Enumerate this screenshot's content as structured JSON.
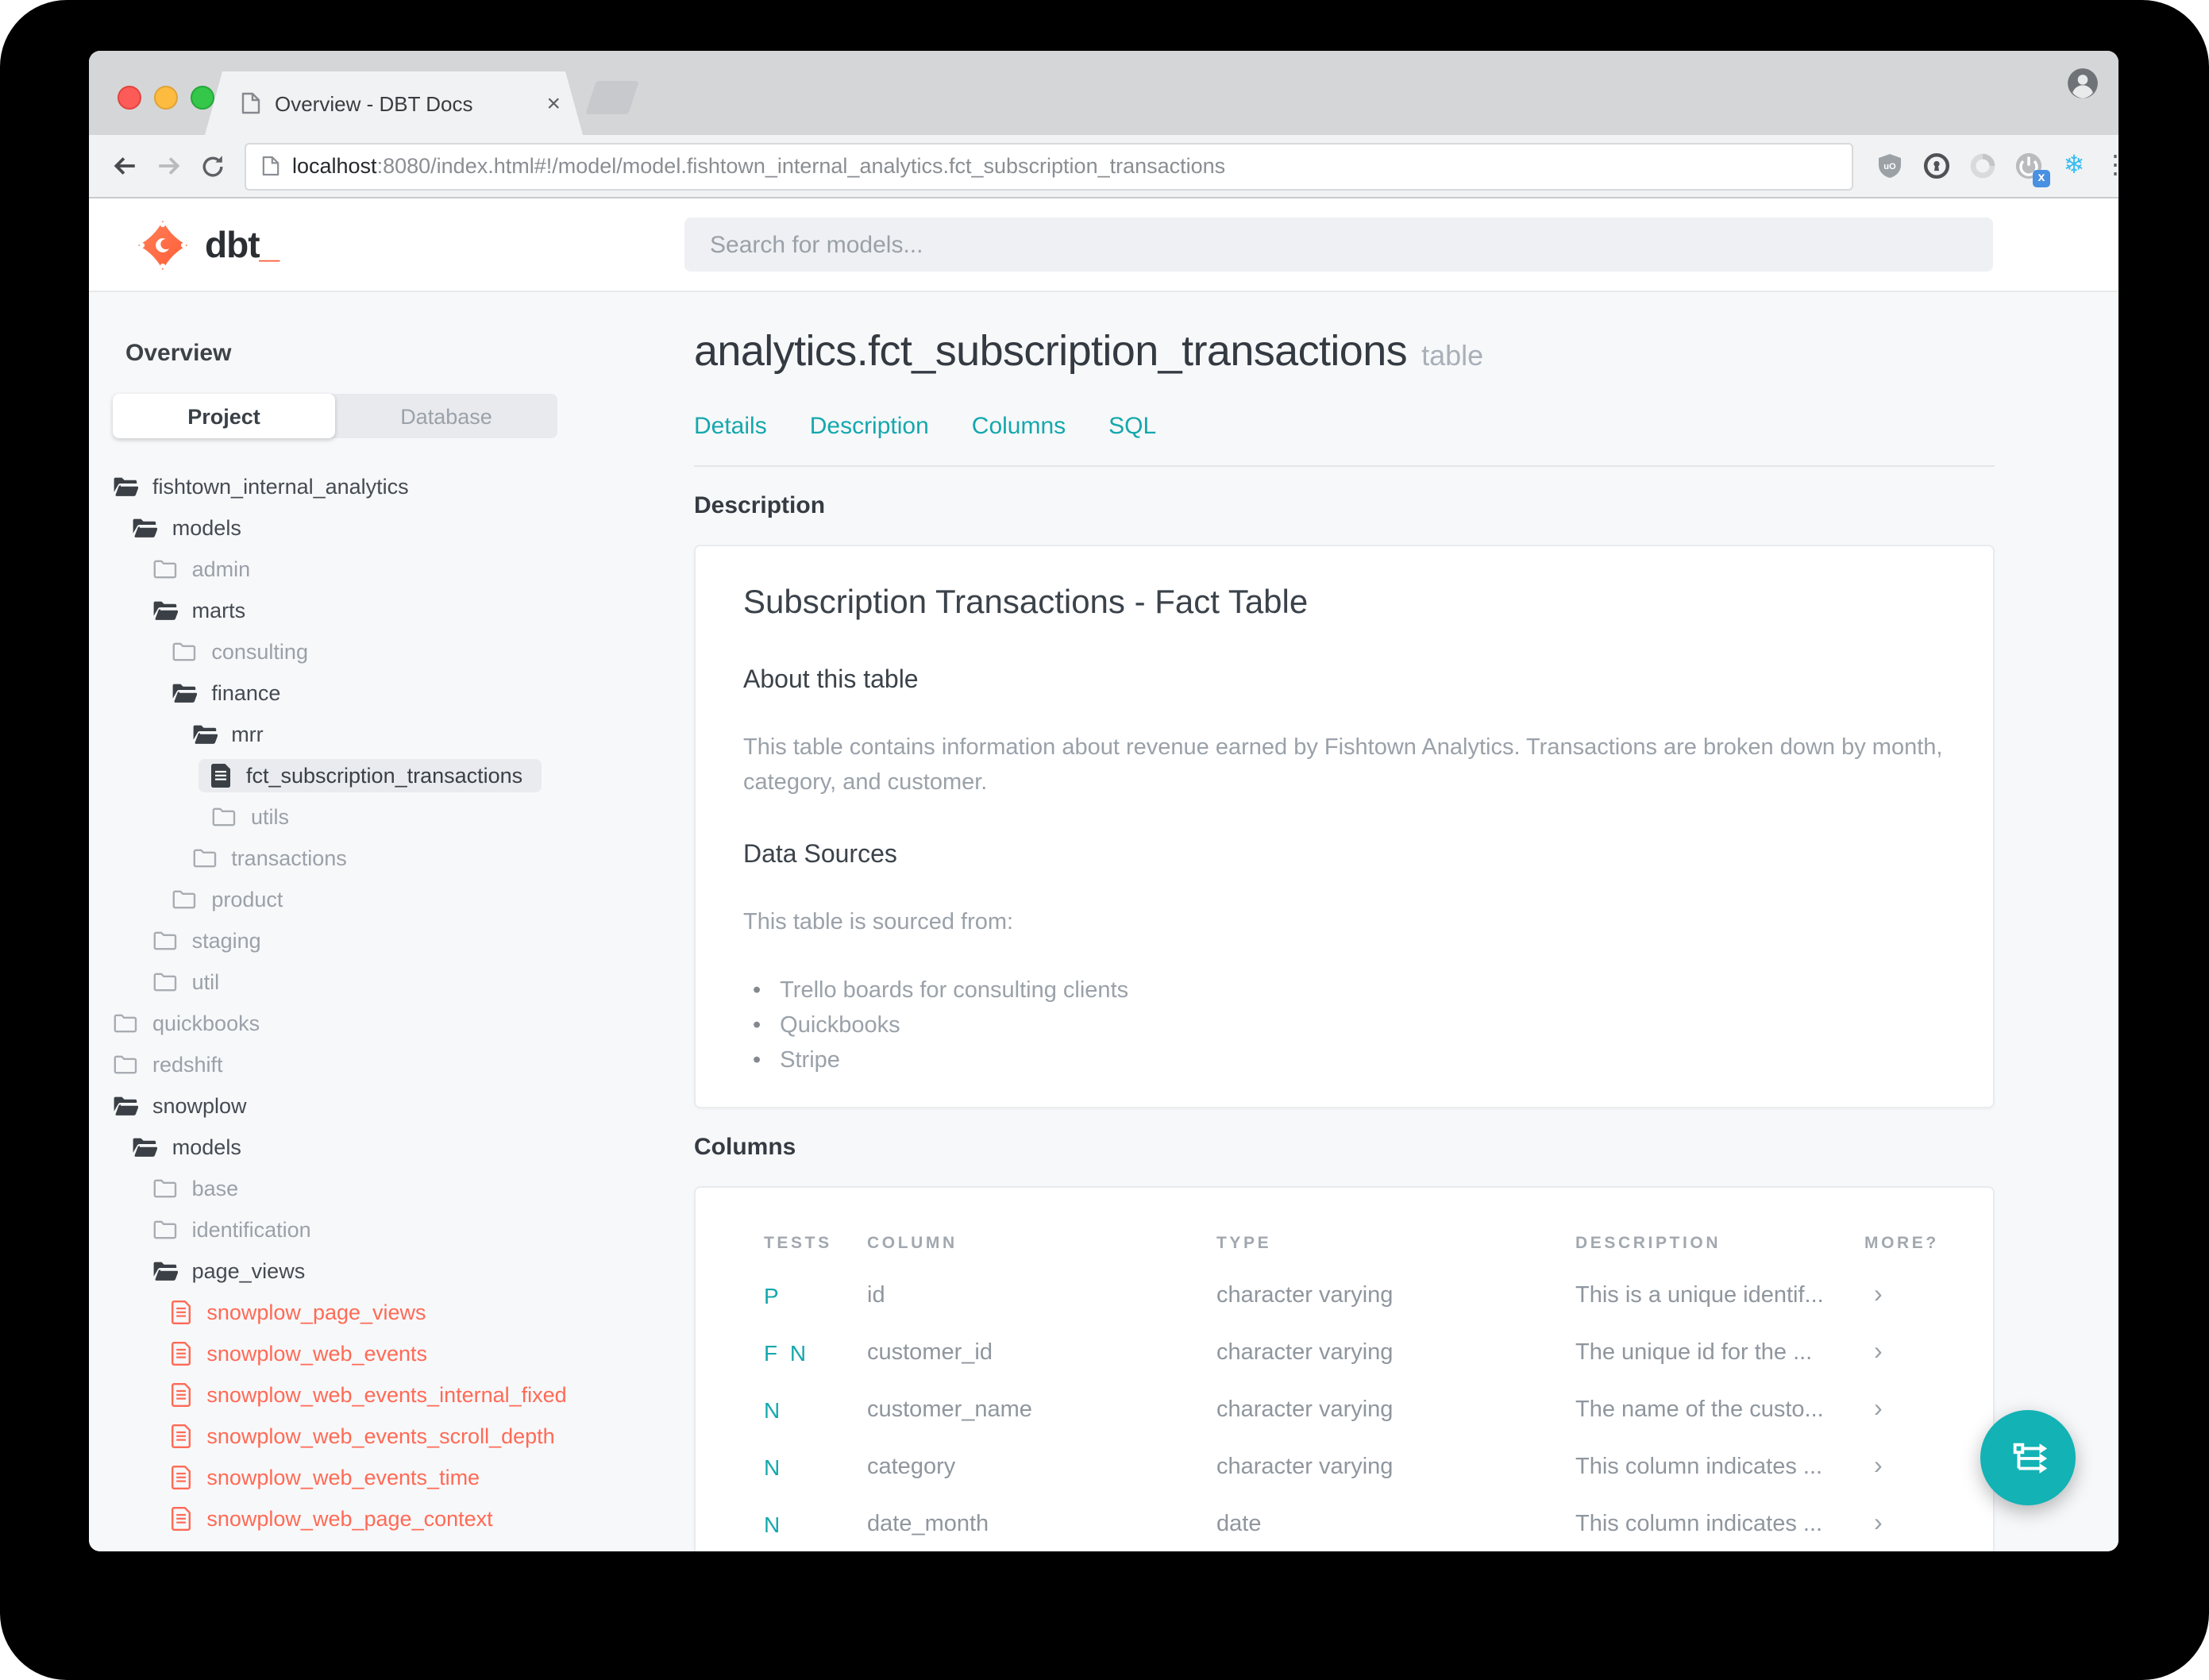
{
  "theme": {
    "teal": "#14a8ad",
    "fab_teal": "#12b2b5",
    "coral": "#ff6a55",
    "brand_orange": "#ff5c35",
    "tabbar_bg": "#d5d6d8",
    "toolbar_bg": "#f1f2f3",
    "page_bg": "#f7f8fa"
  },
  "browser": {
    "window_controls": [
      "close",
      "minimize",
      "zoom"
    ],
    "tab": {
      "title": "Overview - DBT Docs",
      "close_glyph": "×",
      "favicon": "document-icon"
    },
    "url": {
      "host": "localhost",
      "rest": ":8080/index.html#!/model/model.fishtown_internal_analytics.fct_subscription_transactions"
    },
    "toolbar_icons": [
      "back-arrow-icon",
      "forward-arrow-icon",
      "reload-icon"
    ],
    "extension_icons": [
      "ublock-origin-icon",
      "onepassword-icon",
      "loop-icon",
      "power-icon",
      "snowflake-icon",
      "browser-menu-icon"
    ],
    "extension_badge": "x",
    "snowflake_glyph": "❄",
    "menu_glyph": "⋮",
    "profile_icon": "profile-avatar-icon"
  },
  "app_header": {
    "logo_text": "dbt",
    "logo_cursor": "_",
    "search": {
      "placeholder": "Search for models...",
      "value": ""
    }
  },
  "sidebar": {
    "heading": "Overview",
    "tabs": [
      {
        "label": "Project",
        "active": true
      },
      {
        "label": "Database",
        "active": false
      }
    ],
    "tree": [
      {
        "label": "fishtown_internal_analytics",
        "level": 0,
        "kind": "folder-open",
        "variant": "dark"
      },
      {
        "label": "models",
        "level": 1,
        "kind": "folder-open",
        "variant": "dark"
      },
      {
        "label": "admin",
        "level": 2,
        "kind": "folder",
        "variant": "muted"
      },
      {
        "label": "marts",
        "level": 2,
        "kind": "folder-open",
        "variant": "dark"
      },
      {
        "label": "consulting",
        "level": 3,
        "kind": "folder",
        "variant": "muted"
      },
      {
        "label": "finance",
        "level": 3,
        "kind": "folder-open",
        "variant": "dark"
      },
      {
        "label": "mrr",
        "level": 4,
        "kind": "folder-open",
        "variant": "dark"
      },
      {
        "label": "fct_subscription_transactions",
        "level": 5,
        "kind": "file-solid",
        "variant": "selected"
      },
      {
        "label": "utils",
        "level": 5,
        "kind": "folder",
        "variant": "muted"
      },
      {
        "label": "transactions",
        "level": 4,
        "kind": "folder",
        "variant": "muted"
      },
      {
        "label": "product",
        "level": 3,
        "kind": "folder",
        "variant": "muted"
      },
      {
        "label": "staging",
        "level": 2,
        "kind": "folder",
        "variant": "muted"
      },
      {
        "label": "util",
        "level": 2,
        "kind": "folder",
        "variant": "muted"
      },
      {
        "label": "quickbooks",
        "level": 0,
        "kind": "folder",
        "variant": "muted"
      },
      {
        "label": "redshift",
        "level": 0,
        "kind": "folder",
        "variant": "muted"
      },
      {
        "label": "snowplow",
        "level": 0,
        "kind": "folder-open",
        "variant": "dark"
      },
      {
        "label": "models",
        "level": 1,
        "kind": "folder-open",
        "variant": "dark"
      },
      {
        "label": "base",
        "level": 2,
        "kind": "folder",
        "variant": "muted"
      },
      {
        "label": "identification",
        "level": 2,
        "kind": "folder",
        "variant": "muted"
      },
      {
        "label": "page_views",
        "level": 2,
        "kind": "folder-open",
        "variant": "dark"
      },
      {
        "label": "snowplow_page_views",
        "level": 3,
        "kind": "file-outline",
        "variant": "red"
      },
      {
        "label": "snowplow_web_events",
        "level": 3,
        "kind": "file-outline",
        "variant": "red"
      },
      {
        "label": "snowplow_web_events_internal_fixed",
        "level": 3,
        "kind": "file-outline",
        "variant": "red"
      },
      {
        "label": "snowplow_web_events_scroll_depth",
        "level": 3,
        "kind": "file-outline",
        "variant": "red"
      },
      {
        "label": "snowplow_web_events_time",
        "level": 3,
        "kind": "file-outline",
        "variant": "red"
      },
      {
        "label": "snowplow_web_page_context",
        "level": 3,
        "kind": "file-outline",
        "variant": "red"
      }
    ]
  },
  "main": {
    "title": "analytics.fct_subscription_transactions",
    "title_badge": "table",
    "nav": [
      "Details",
      "Description",
      "Columns",
      "SQL"
    ],
    "description": {
      "heading": "Description",
      "card_title": "Subscription Transactions - Fact Table",
      "about_heading": "About this table",
      "about_text": "This table contains information about revenue earned by Fishtown Analytics. Transactions are broken down by month, category, and customer.",
      "sources_heading": "Data Sources",
      "sources_intro": "This table is sourced from:",
      "sources": [
        "Trello boards for consulting clients",
        "Quickbooks",
        "Stripe"
      ]
    },
    "columns": {
      "heading": "Columns",
      "headers": [
        "TESTS",
        "COLUMN",
        "TYPE",
        "DESCRIPTION",
        "MORE?"
      ],
      "more_glyph": "›",
      "rows": [
        {
          "tests": "P",
          "column": "id",
          "type": "character varying",
          "description": "This is a unique identif..."
        },
        {
          "tests": "F N",
          "column": "customer_id",
          "type": "character varying",
          "description": "The unique id for the ..."
        },
        {
          "tests": "N",
          "column": "customer_name",
          "type": "character varying",
          "description": "The name of the custo..."
        },
        {
          "tests": "N",
          "column": "category",
          "type": "character varying",
          "description": "This column indicates ..."
        },
        {
          "tests": "N",
          "column": "date_month",
          "type": "date",
          "description": "This column indicates ..."
        }
      ]
    }
  },
  "fab": {
    "icon": "lineage-graph-icon"
  }
}
